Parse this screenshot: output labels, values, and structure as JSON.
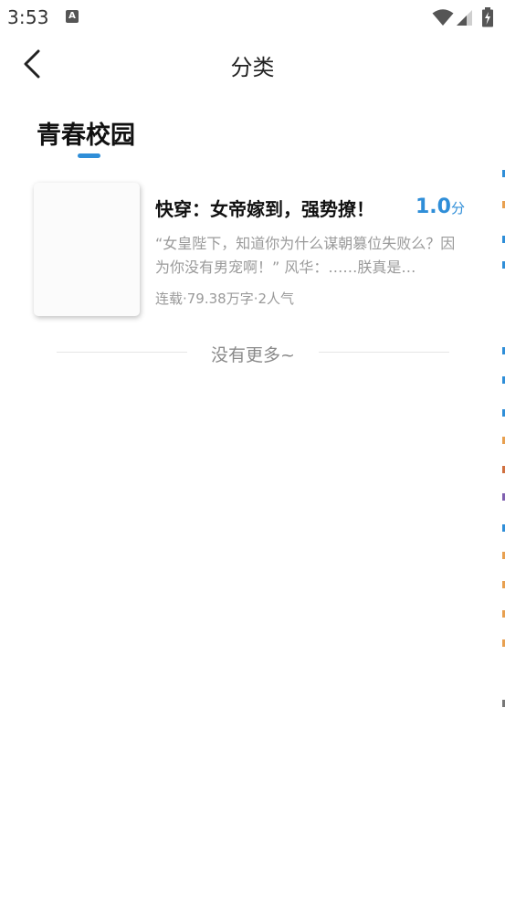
{
  "status_bar": {
    "time": "3:53",
    "notification_icon": "A"
  },
  "header": {
    "title": "分类",
    "back_icon": "chevron-left-icon"
  },
  "category_tab": {
    "label": "青春校园",
    "active": true,
    "accent_color": "#2f8ed8"
  },
  "books": [
    {
      "title": "快穿：女帝嫁到，强势撩！",
      "score_value": "1.0",
      "score_unit": "分",
      "description": "“女皇陛下，知道你为什么谋朝篡位失败么？因为你没有男宠啊！” 风华：……朕真是…",
      "meta": "连载·79.38万字·2人气"
    }
  ],
  "list_footer": {
    "text": "没有更多~"
  },
  "colors": {
    "accent": "#2f8ed8",
    "muted_text": "#9a9a9a"
  }
}
